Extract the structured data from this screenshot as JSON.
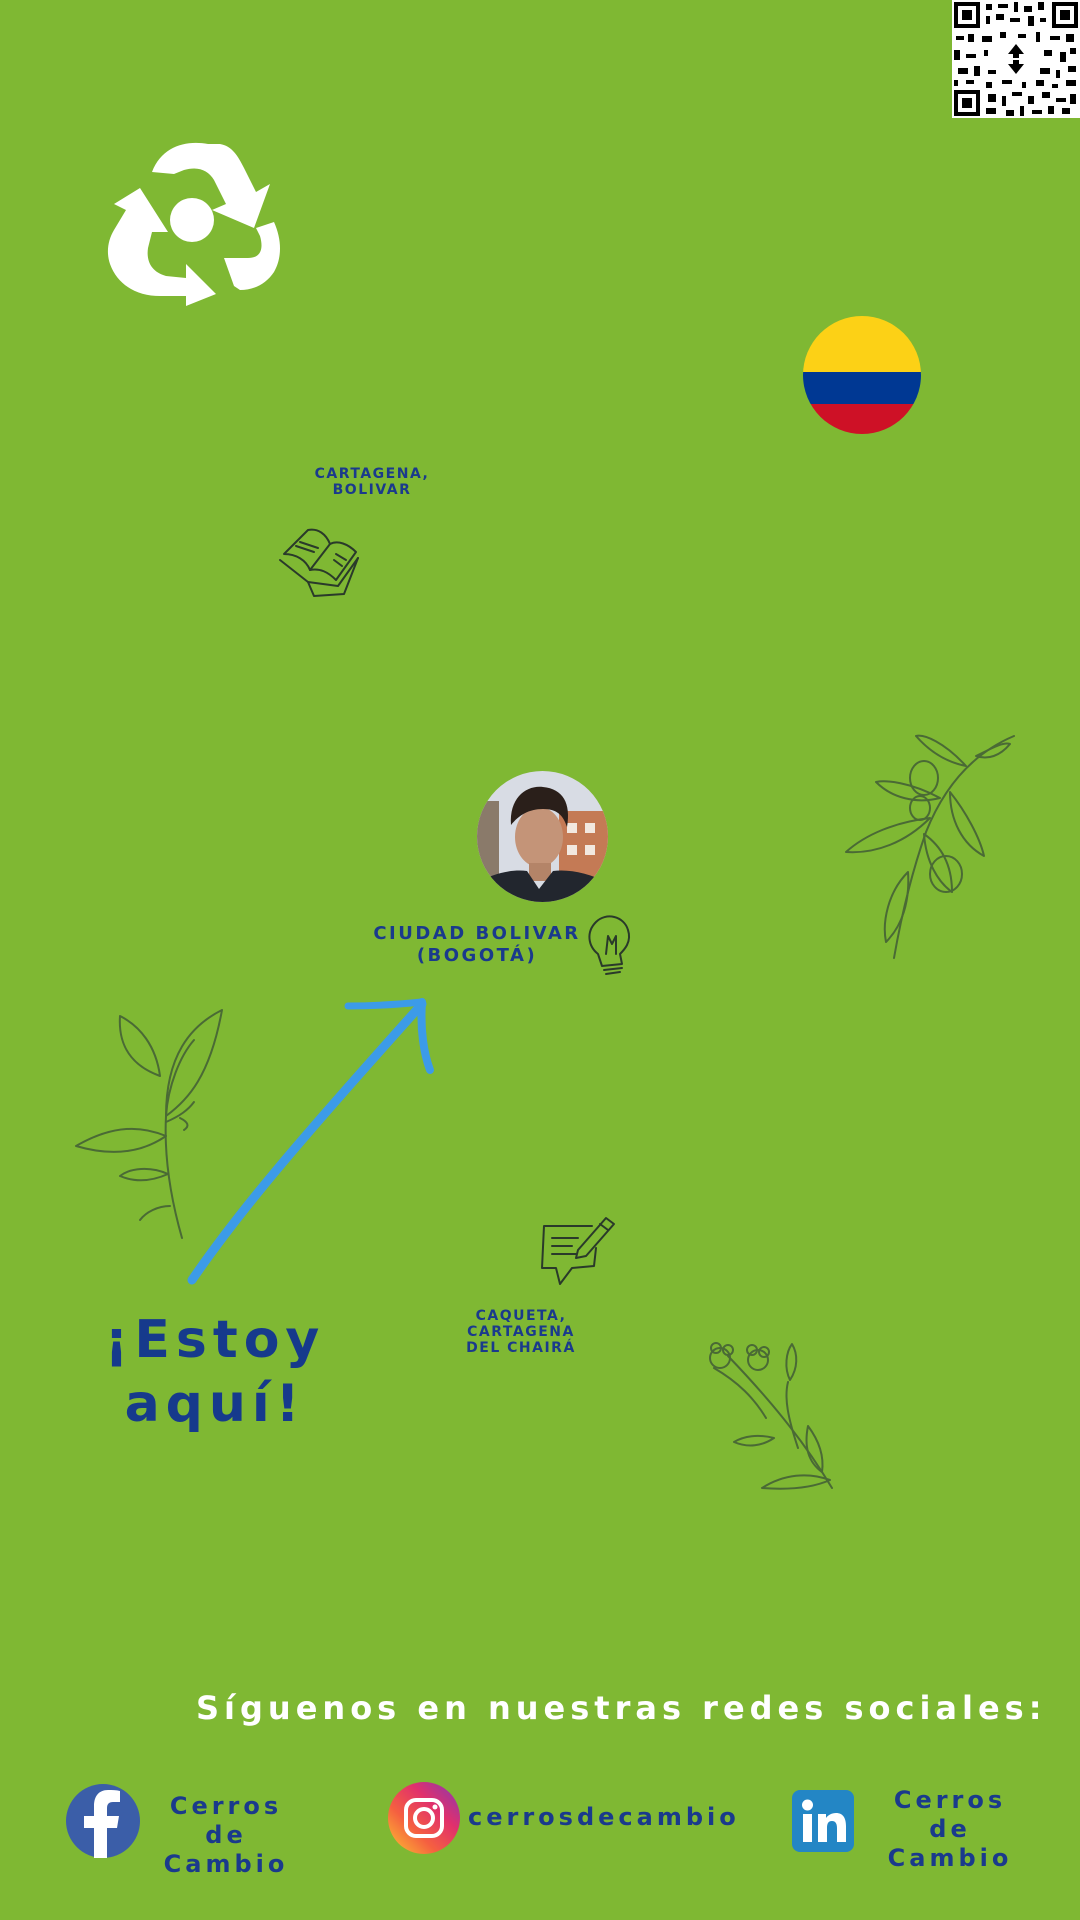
{
  "locations": {
    "cartagena": [
      "CARTAGENA,",
      "BOLIVAR"
    ],
    "ciudad_bolivar": [
      "CIUDAD BOLIVAR",
      "(BOGOTÁ)"
    ],
    "caqueta": [
      "CAQUETA,",
      "CARTAGENA",
      "DEL CHAIRÁ"
    ]
  },
  "headline": [
    "¡Estoy",
    "aquí!"
  ],
  "follow_text": "Síguenos en nuestras redes sociales:",
  "social": {
    "facebook": [
      "Cerros de",
      "Cambio"
    ],
    "instagram": "cerrosdecambio",
    "linkedin": [
      "Cerros de",
      "Cambio"
    ]
  },
  "colors": {
    "background": "#7fb833",
    "navy_text": "#1a3a8c",
    "arrow": "#3c9be8",
    "flag_yellow": "#fcd116",
    "flag_blue": "#003893",
    "flag_red": "#ce1126"
  },
  "icons": [
    "qr-code-icon",
    "recycle-icon",
    "colombia-flag-icon",
    "book-icon",
    "lightbulb-icon",
    "note-pencil-icon",
    "facebook-icon",
    "instagram-icon",
    "linkedin-icon",
    "arrow-icon",
    "olive-branch-icon",
    "leaf-sprig-icon",
    "flower-sprig-icon"
  ]
}
